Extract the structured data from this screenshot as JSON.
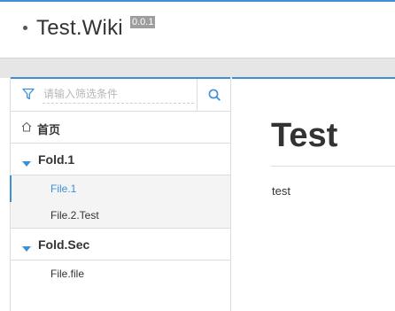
{
  "header": {
    "title": "Test.Wiki",
    "version": "0.0.1"
  },
  "sidebar": {
    "filter": {
      "placeholder": "请输入筛选条件",
      "value": ""
    },
    "home": {
      "label": "首页",
      "icon": "home-icon"
    },
    "folders": [
      {
        "label": "Fold.1",
        "files": [
          {
            "label": "File.1",
            "active": true
          },
          {
            "label": "File.2.Test",
            "active": false
          }
        ]
      },
      {
        "label": "Fold.Sec",
        "files": [
          {
            "label": "File.file",
            "active": false
          }
        ]
      }
    ]
  },
  "content": {
    "title": "Test",
    "body": "test"
  },
  "colors": {
    "accent": "#3d8fd6",
    "text": "#333333",
    "border": "#dcdcdc",
    "band": "#e6e6e6",
    "version_badge": "#9e9e9e"
  }
}
